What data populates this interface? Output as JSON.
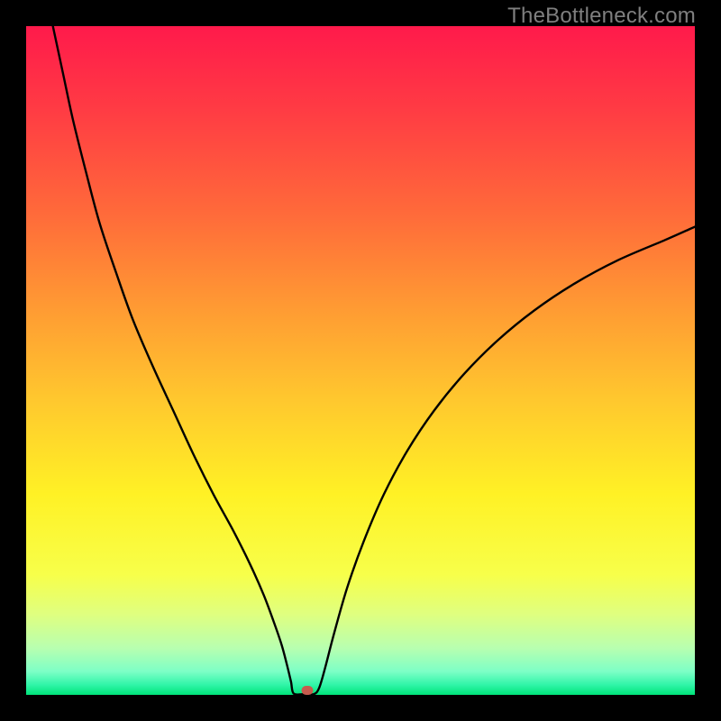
{
  "watermark": "TheBottleneck.com",
  "chart_data": {
    "type": "line",
    "title": "",
    "xlabel": "",
    "ylabel": "",
    "xlim": [
      0,
      100
    ],
    "ylim": [
      0,
      100
    ],
    "grid": false,
    "legend_position": "none",
    "background_gradient_stops": [
      {
        "pos": 0.0,
        "color": "#ff1a4b"
      },
      {
        "pos": 0.12,
        "color": "#ff3a44"
      },
      {
        "pos": 0.28,
        "color": "#ff6a3a"
      },
      {
        "pos": 0.42,
        "color": "#ff9a33"
      },
      {
        "pos": 0.56,
        "color": "#ffc82e"
      },
      {
        "pos": 0.7,
        "color": "#fff125"
      },
      {
        "pos": 0.82,
        "color": "#f7ff4a"
      },
      {
        "pos": 0.88,
        "color": "#dfff80"
      },
      {
        "pos": 0.93,
        "color": "#b8ffb0"
      },
      {
        "pos": 0.965,
        "color": "#7dffc6"
      },
      {
        "pos": 0.985,
        "color": "#30f5a8"
      },
      {
        "pos": 1.0,
        "color": "#00e47a"
      }
    ],
    "series": [
      {
        "name": "bottleneck-curve",
        "color": "#000000",
        "x": [
          4.0,
          5.5,
          7.0,
          9.0,
          11.0,
          13.5,
          16.0,
          19.0,
          22.0,
          25.0,
          28.0,
          31.0,
          33.5,
          35.5,
          37.0,
          38.2,
          39.0,
          39.6,
          40.0,
          41.5,
          43.0,
          43.8,
          44.7,
          46.0,
          48.0,
          50.5,
          53.5,
          57.0,
          61.0,
          65.5,
          70.5,
          76.0,
          82.0,
          88.5,
          95.5,
          100.0
        ],
        "y": [
          100.0,
          93.0,
          86.0,
          78.0,
          70.5,
          63.0,
          56.0,
          49.0,
          42.5,
          36.0,
          30.0,
          24.5,
          19.5,
          15.0,
          11.0,
          7.5,
          4.5,
          2.0,
          0.2,
          0.1,
          0.1,
          1.0,
          4.0,
          9.0,
          16.0,
          23.0,
          30.0,
          36.5,
          42.5,
          48.0,
          53.0,
          57.5,
          61.5,
          65.0,
          68.0,
          70.0
        ]
      }
    ],
    "marker": {
      "x": 42.0,
      "y": 0.7,
      "color": "#c65b4e"
    },
    "annotations": []
  }
}
